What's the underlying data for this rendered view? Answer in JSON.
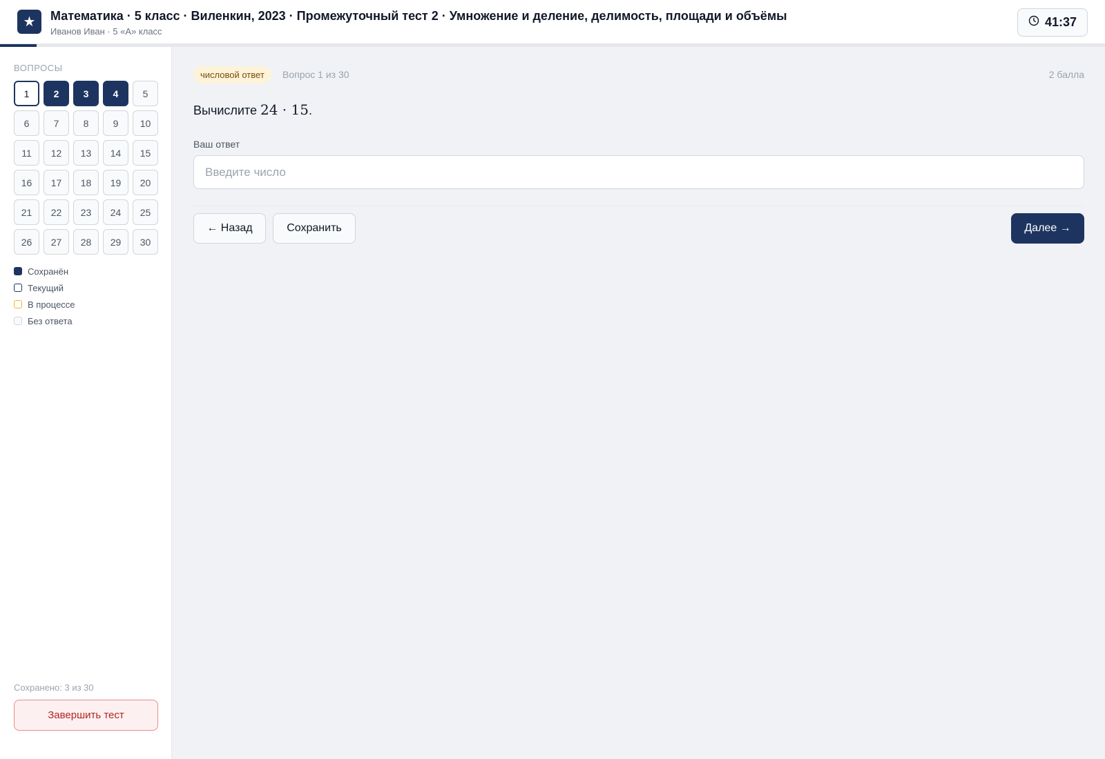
{
  "header": {
    "logo_glyph": "★",
    "title": "Математика · 5 класс · Виленкин, 2023 · Промежуточный тест 2 · Умножение и деление, делимость, площади и объёмы",
    "subtitle": "Иванов Иван · 5 «А» класс",
    "timer": "41:37",
    "progress_fraction": 0.033
  },
  "sidebar": {
    "heading": "Вопросы",
    "questions": [
      {
        "n": "1",
        "state": "current"
      },
      {
        "n": "2",
        "state": "saved"
      },
      {
        "n": "3",
        "state": "saved"
      },
      {
        "n": "4",
        "state": "saved"
      },
      {
        "n": "5",
        "state": "empty"
      },
      {
        "n": "6",
        "state": "empty"
      },
      {
        "n": "7",
        "state": "empty"
      },
      {
        "n": "8",
        "state": "empty"
      },
      {
        "n": "9",
        "state": "empty"
      },
      {
        "n": "10",
        "state": "empty"
      },
      {
        "n": "11",
        "state": "empty"
      },
      {
        "n": "12",
        "state": "empty"
      },
      {
        "n": "13",
        "state": "empty"
      },
      {
        "n": "14",
        "state": "empty"
      },
      {
        "n": "15",
        "state": "empty"
      },
      {
        "n": "16",
        "state": "empty"
      },
      {
        "n": "17",
        "state": "empty"
      },
      {
        "n": "18",
        "state": "empty"
      },
      {
        "n": "19",
        "state": "empty"
      },
      {
        "n": "20",
        "state": "empty"
      },
      {
        "n": "21",
        "state": "empty"
      },
      {
        "n": "22",
        "state": "empty"
      },
      {
        "n": "23",
        "state": "empty"
      },
      {
        "n": "24",
        "state": "empty"
      },
      {
        "n": "25",
        "state": "empty"
      },
      {
        "n": "26",
        "state": "empty"
      },
      {
        "n": "27",
        "state": "empty"
      },
      {
        "n": "28",
        "state": "empty"
      },
      {
        "n": "29",
        "state": "empty"
      },
      {
        "n": "30",
        "state": "empty"
      }
    ],
    "legend": {
      "saved": "Сохранён",
      "current": "Текущий",
      "in_progress": "В процессе",
      "no_answer": "Без ответа"
    },
    "saved_count": "Сохранено: 3 из 30",
    "finish_label": "Завершить тест"
  },
  "main": {
    "badge": "числовой ответ",
    "question_counter": "Вопрос 1 из 30",
    "points": "2 балла",
    "question_text": "Вычислите ",
    "question_math": "24 · 15",
    "question_end": ".",
    "answer_label": "Ваш ответ",
    "answer_value": "",
    "answer_placeholder": "Введите число",
    "back_label": "← Назад",
    "save_label": "Сохранить",
    "next_label": "Далее →"
  },
  "colors": {
    "primary": "#1e3460",
    "in_progress": "#f5b32e",
    "danger": "#b42323",
    "badge_bg": "#fdf3d9"
  }
}
